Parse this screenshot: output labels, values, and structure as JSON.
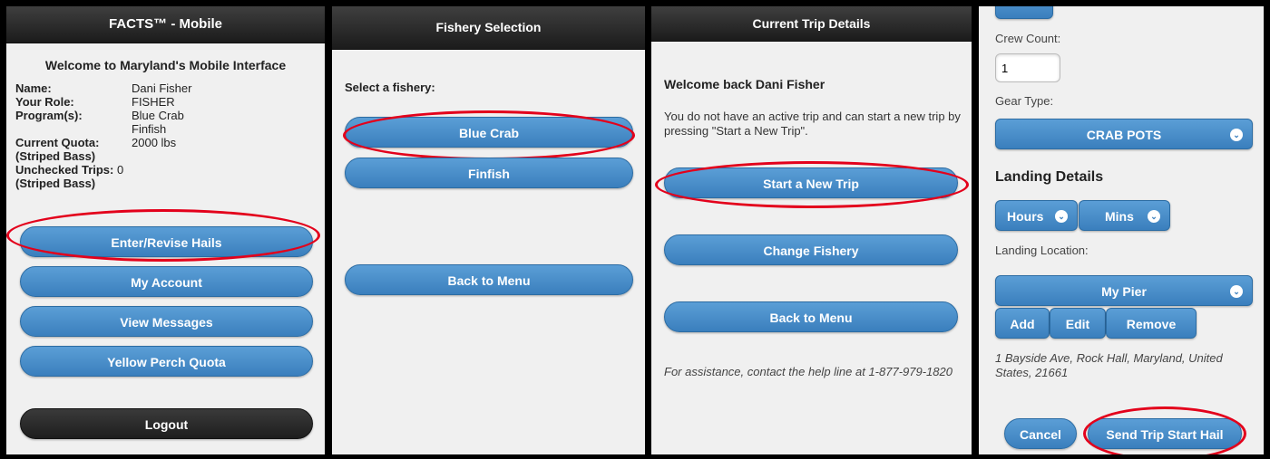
{
  "panel1": {
    "title": "FACTS™ - Mobile",
    "welcome": "Welcome to Maryland's Mobile Interface",
    "name_label": "Name:",
    "name_value": "Dani Fisher",
    "role_label": "Your Role:",
    "role_value": "FISHER",
    "programs_label": "Program(s):",
    "program_1": "Blue Crab",
    "program_2": "Finfish",
    "quota_label": "Current Quota:",
    "quota_value": "2000 lbs",
    "quota_sub": "(Striped Bass)",
    "unchecked_label": "Unchecked Trips:",
    "unchecked_value": "0",
    "unchecked_sub": "(Striped Bass)",
    "btn_hails": "Enter/Revise Hails",
    "btn_account": "My Account",
    "btn_messages": "View Messages",
    "btn_perch": "Yellow Perch Quota",
    "btn_logout": "Logout"
  },
  "panel2": {
    "title": "Fishery Selection",
    "prompt": "Select a fishery:",
    "btn_bluecrab": "Blue Crab",
    "btn_finfish": "Finfish",
    "btn_back": "Back to Menu"
  },
  "panel3": {
    "title": "Current Trip Details",
    "welcome": "Welcome back Dani Fisher",
    "info": "You do not have an active trip and can start a new trip by pressing \"Start a New Trip\".",
    "btn_start": "Start a New Trip",
    "btn_change": "Change Fishery",
    "btn_back": "Back to Menu",
    "assist": "For assistance, contact the help line at 1-877-979-1820"
  },
  "panel4": {
    "crew_label": "Crew Count:",
    "crew_value": "1",
    "gear_label": "Gear Type:",
    "gear_value": "CRAB POTS",
    "landing_heading": "Landing Details",
    "hours": "Hours",
    "mins": "Mins",
    "location_label": "Landing Location:",
    "location_value": "My Pier",
    "btn_add": "Add",
    "btn_edit": "Edit",
    "btn_remove": "Remove",
    "address": "1 Bayside Ave, Rock Hall, Maryland, United States, 21661",
    "btn_cancel": "Cancel",
    "btn_send": "Send Trip Start Hail"
  },
  "colors": {
    "accent": "#3a7fbd",
    "highlight": "#e3001b",
    "header": "#2a2a2a"
  }
}
